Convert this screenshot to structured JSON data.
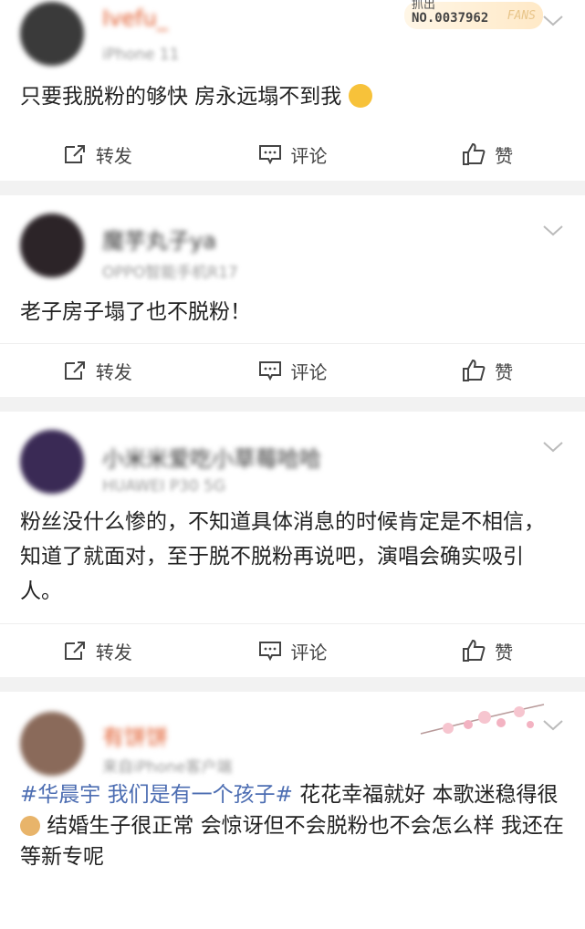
{
  "posts": [
    {
      "username": "Ivefu_",
      "meta": "iPhone 11",
      "badge": {
        "top": "抓出",
        "number": "NO.0037962",
        "fans": "FANS"
      },
      "content": "只要我脱粉的够快 房永远塌不到我",
      "avatar_color": "#3a3a3a",
      "actions": {
        "repost": "转发",
        "comment": "评论",
        "like": "赞"
      }
    },
    {
      "username": "魔芋丸子ya",
      "meta": "OPPO智能手机R17",
      "content": "老子房子塌了也不脱粉！",
      "avatar_color": "#2c2428",
      "actions": {
        "repost": "转发",
        "comment": "评论",
        "like": "赞"
      }
    },
    {
      "username": "小米米爱吃小草莓哈哈",
      "meta": "HUAWEI P30 5G",
      "content": "粉丝没什么惨的，不知道具体消息的时候肯定是不相信，知道了就面对，至于脱不脱粉再说吧，演唱会确实吸引人。",
      "avatar_color": "#3a2a55",
      "actions": {
        "repost": "转发",
        "comment": "评论",
        "like": "赞"
      }
    },
    {
      "username": "有饼饼",
      "meta": "来自iPhone客户端",
      "topic": "#华晨宇 我们是有一个孩子#",
      "content_part1": "花花幸福就好 本歌迷稳得很",
      "content_part2": "结婚生子很正常 会惊讶但不会脱粉也不会怎么样 我还在等新专呢",
      "avatar_color": "#8a6a5a"
    }
  ],
  "colors": {
    "topic": "#4c6db2",
    "background": "#f2f2f2",
    "text": "#222222",
    "meta": "#999999"
  }
}
